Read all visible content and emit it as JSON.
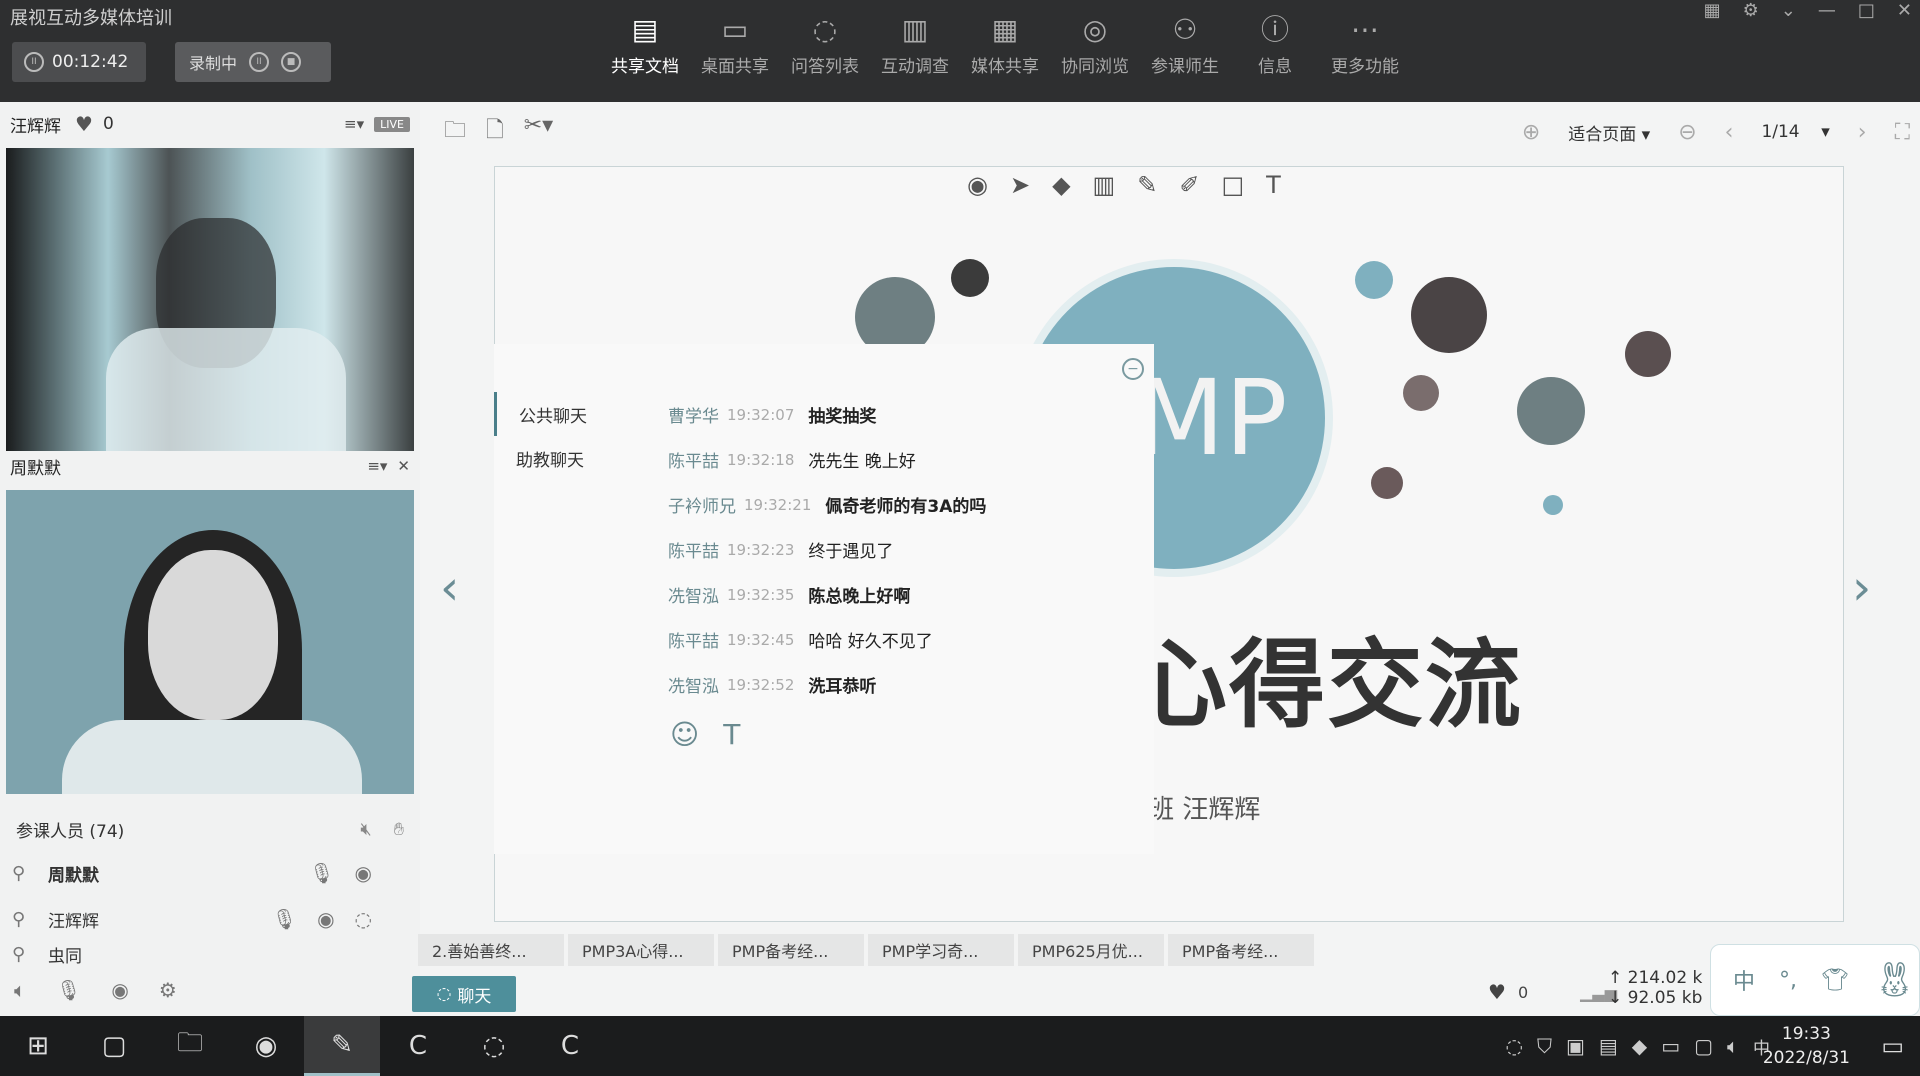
{
  "app": {
    "title": "展视互动多媒体培训"
  },
  "recording": {
    "time": "00:12:42",
    "status": "录制中"
  },
  "toolbar": [
    {
      "label": "共享文档",
      "icon": "document-icon",
      "glyph": "▤",
      "active": true
    },
    {
      "label": "桌面共享",
      "icon": "desktop-share-icon",
      "glyph": "▭"
    },
    {
      "label": "问答列表",
      "icon": "qa-icon",
      "glyph": "◌"
    },
    {
      "label": "互动调查",
      "icon": "survey-icon",
      "glyph": "▥"
    },
    {
      "label": "媒体共享",
      "icon": "media-icon",
      "glyph": "▦"
    },
    {
      "label": "协同浏览",
      "icon": "browse-icon",
      "glyph": "◎"
    },
    {
      "label": "参课师生",
      "icon": "people-icon",
      "glyph": "⚇"
    },
    {
      "label": "信息",
      "icon": "info-icon",
      "glyph": "ⓘ"
    },
    {
      "label": "更多功能",
      "icon": "more-icon",
      "glyph": "⋯"
    }
  ],
  "video1": {
    "name": "汪辉辉",
    "likes": "0",
    "badge": "LIVE"
  },
  "video2": {
    "name": "周默默"
  },
  "participants": {
    "header": "参课人员 (74)",
    "list": [
      {
        "name": "周默默"
      },
      {
        "name": "汪辉辉"
      },
      {
        "name": "虫同"
      }
    ]
  },
  "doc": {
    "zoom": "适合页面",
    "page": "1/14"
  },
  "slide": {
    "mp": "MP",
    "title": "心得交流",
    "subtitle": "84班 汪辉辉"
  },
  "chat": {
    "tabs": [
      "公共聊天",
      "助教聊天"
    ],
    "messages": [
      {
        "sender": "曹学华",
        "time": "19:32:07",
        "text": "抽奖抽奖",
        "bold": true
      },
      {
        "sender": "陈平喆",
        "time": "19:32:18",
        "text": "冼先生  晚上好",
        "bold": false
      },
      {
        "sender": "子衿师兄",
        "time": "19:32:21",
        "text": "佩奇老师的有3A的吗",
        "bold": true
      },
      {
        "sender": "陈平喆",
        "time": "19:32:23",
        "text": "终于遇见了",
        "bold": false
      },
      {
        "sender": "冼智泓",
        "time": "19:32:35",
        "text": "陈总晚上好啊",
        "bold": true
      },
      {
        "sender": "陈平喆",
        "time": "19:32:45",
        "text": "哈哈  好久不见了",
        "bold": false
      },
      {
        "sender": "冼智泓",
        "time": "19:32:52",
        "text": "洗耳恭听",
        "bold": true
      }
    ]
  },
  "files": [
    "2.善始善终...",
    "PMP3A心得...",
    "PMP备考经...",
    "PMP学习奇...",
    "PMP625月优...",
    "PMP备考经..."
  ],
  "chat_button": "聊天",
  "stats": {
    "likes": "0",
    "up": "214.02 k",
    "down": "92.05 kb"
  },
  "ime": {
    "lang": "中",
    "punct": "°,"
  },
  "clock": {
    "time": "19:33",
    "date": "2022/8/31"
  }
}
